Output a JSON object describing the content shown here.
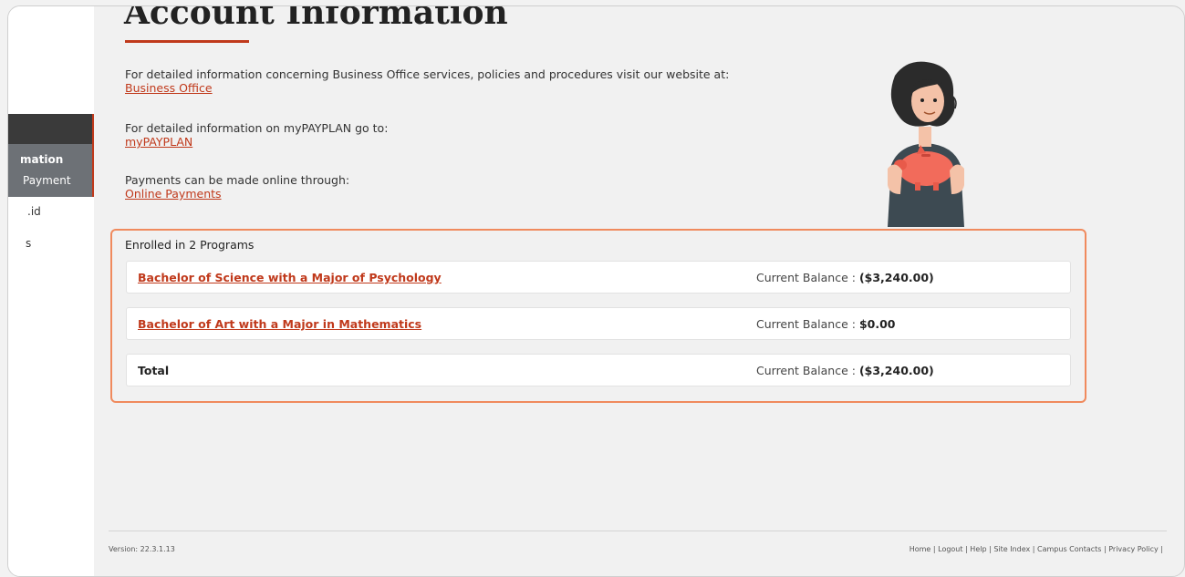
{
  "page": {
    "title": "Account Information"
  },
  "sidebar": {
    "items": [
      {
        "label": "mation"
      },
      {
        "label": "Payment"
      },
      {
        "label": ".id"
      },
      {
        "label": "s"
      }
    ]
  },
  "info": {
    "business_text": "For detailed information concerning Business Office services, policies and procedures visit our website at:",
    "business_link": "Business Office",
    "payplan_text": "For detailed information on myPAYPLAN go to:",
    "payplan_link": "myPAYPLAN",
    "payments_text": "Payments can be made online through:",
    "payments_link": "Online Payments"
  },
  "illustration": {
    "icon": "piggy-bank-illustration",
    "colors": {
      "hair": "#2b2b2b",
      "shirt": "#3d4a52",
      "piggy": "#f26b5b",
      "skin": "#f4c2a8"
    }
  },
  "programs": {
    "heading": "Enrolled in 2 Programs",
    "balance_label": "Current Balance :",
    "rows": [
      {
        "name": "Bachelor of Science with a Major of Psychology",
        "balance": "($3,240.00)"
      },
      {
        "name": "Bachelor of Art with a Major in Mathematics",
        "balance": "$0.00"
      }
    ],
    "total": {
      "name": "Total",
      "balance": "($3,240.00)"
    }
  },
  "footer": {
    "version": "Version: 22.3.1.13",
    "links": "Home | Logout | Help | Site Index | Campus Contacts | Privacy Policy |"
  },
  "colors": {
    "accent": "#c0391b",
    "highlight_border": "#f08a5d",
    "sidebar_dark": "#3a3a3a",
    "sidebar_active": "#6d7176"
  }
}
